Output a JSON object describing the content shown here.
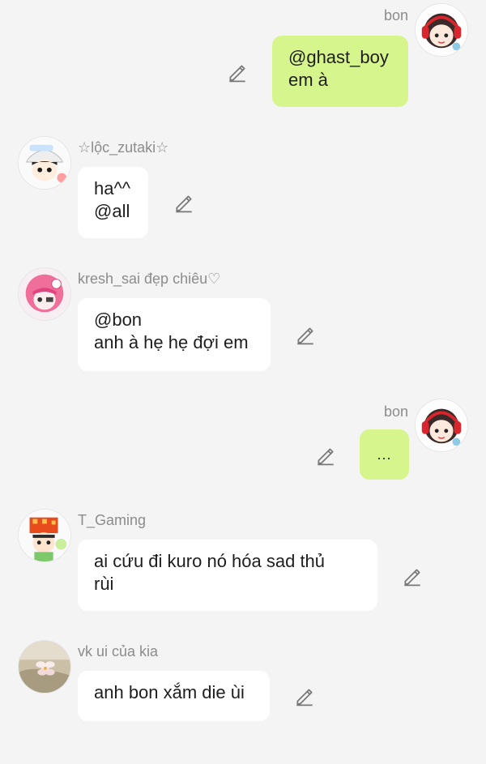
{
  "messages": [
    {
      "sender": "bon",
      "text": "@ghast_boy\nem à",
      "avatar_icon": "avatar-red-headphones-icon"
    },
    {
      "sender": "☆lộc_zutaki☆",
      "text": "ha^^\n@all",
      "avatar_icon": "avatar-white-cap-icon"
    },
    {
      "sender": "kresh_sai đẹp chiêu♡",
      "text": "@bon\nanh à hẹ hẹ đợi em",
      "avatar_icon": "avatar-pink-hair-icon"
    },
    {
      "sender": "bon",
      "text": "...",
      "avatar_icon": "avatar-red-headphones-icon"
    },
    {
      "sender": "T_Gaming",
      "text": "ai cứu đi kuro nó hóa sad thủ\nrùi",
      "avatar_icon": "avatar-orange-pixel-icon"
    },
    {
      "sender": "vk ui của kia",
      "text": "anh bon xắm die ùi",
      "avatar_icon": "avatar-flower-photo-icon"
    }
  ],
  "icons": {
    "edit": "pencil-icon"
  },
  "colors": {
    "background": "#f4f4f4",
    "outgoing_bubble": "#d7f58d",
    "incoming_bubble": "#ffffff",
    "name_text": "#8c8c8c"
  }
}
